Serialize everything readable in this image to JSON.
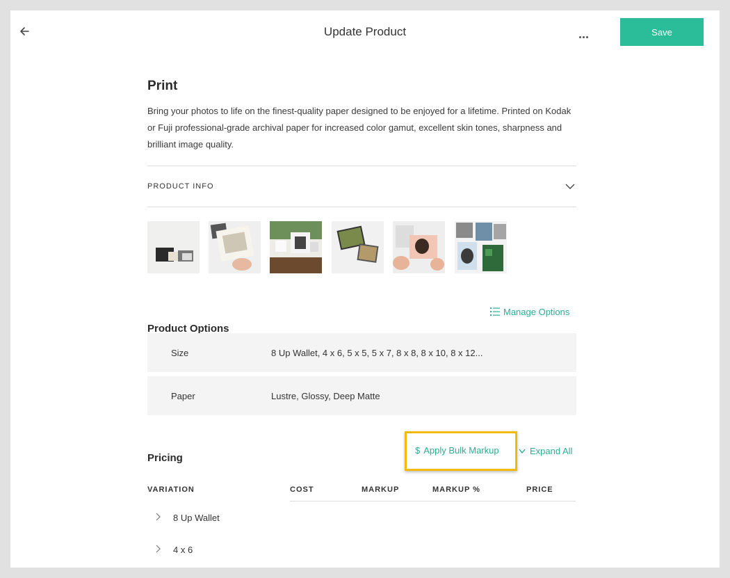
{
  "header": {
    "title": "Update Product",
    "save_label": "Save"
  },
  "product": {
    "name": "Print",
    "description": "Bring your photos to life on the finest-quality paper designed to be enjoyed for a lifetime. Printed on Kodak or Fuji professional-grade archival paper for increased color gamut, excellent skin tones, sharpness and brilliant image quality.",
    "info_label": "PRODUCT INFO"
  },
  "options": {
    "title": "Product Options",
    "manage_label": "Manage Options",
    "rows": [
      {
        "name": "Size",
        "values": "8 Up Wallet, 4 x 6, 5 x 5, 5 x 7, 8 x 8, 8 x 10, 8 x 12..."
      },
      {
        "name": "Paper",
        "values": "Lustre, Glossy, Deep Matte"
      }
    ]
  },
  "pricing": {
    "title": "Pricing",
    "bulk_markup_label": "Apply Bulk Markup",
    "expand_all_label": "Expand All",
    "columns": [
      "VARIATION",
      "COST",
      "MARKUP",
      "MARKUP %",
      "PRICE"
    ],
    "variations": [
      "8 Up Wallet",
      "4 x 6"
    ]
  },
  "colors": {
    "accent": "#2bbd9a",
    "highlight": "#f5b90c"
  }
}
